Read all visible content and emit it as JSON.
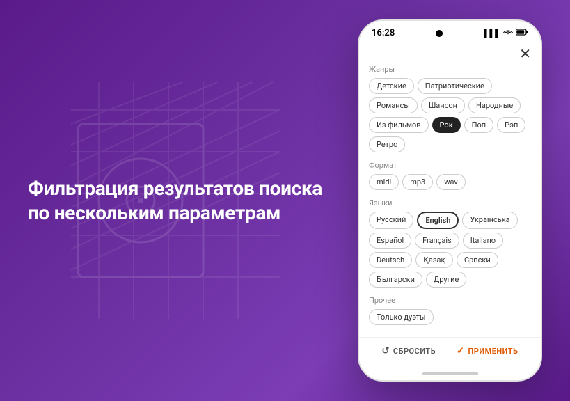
{
  "background": {
    "color": "#6b2fa0"
  },
  "left": {
    "title": "Фильтрация результатов поиска по нескольким параметрам"
  },
  "phone": {
    "status_bar": {
      "time": "16:28",
      "notch": "●",
      "signal": "▌▌▌",
      "wifi": "WiFi",
      "battery": "▮"
    },
    "close_button": "✕",
    "sections": [
      {
        "id": "genres",
        "label": "Жанры",
        "tags": [
          {
            "label": "Детские",
            "active": false
          },
          {
            "label": "Патриотические",
            "active": false
          },
          {
            "label": "Романсы",
            "active": false
          },
          {
            "label": "Шансон",
            "active": false
          },
          {
            "label": "Народные",
            "active": false
          },
          {
            "label": "Из фильмов",
            "active": false
          },
          {
            "label": "Рок",
            "active": true
          },
          {
            "label": "Поп",
            "active": false
          },
          {
            "label": "Рэп",
            "active": false
          },
          {
            "label": "Ретро",
            "active": false
          }
        ]
      },
      {
        "id": "format",
        "label": "Формат",
        "tags": [
          {
            "label": "midi",
            "active": false
          },
          {
            "label": "mp3",
            "active": false
          },
          {
            "label": "wav",
            "active": false
          }
        ]
      },
      {
        "id": "languages",
        "label": "Языки",
        "tags": [
          {
            "label": "Русский",
            "active": false
          },
          {
            "label": "English",
            "active": true,
            "highlight": true
          },
          {
            "label": "Українська",
            "active": false
          },
          {
            "label": "Español",
            "active": false
          },
          {
            "label": "Français",
            "active": false
          },
          {
            "label": "Italiano",
            "active": false
          },
          {
            "label": "Deutsch",
            "active": false
          },
          {
            "label": "Қазақ",
            "active": false
          },
          {
            "label": "Српски",
            "active": false
          },
          {
            "label": "Български",
            "active": false
          },
          {
            "label": "Другие",
            "active": false
          }
        ]
      },
      {
        "id": "other",
        "label": "Прочее",
        "tags": [
          {
            "label": "Только дуэты",
            "active": false
          }
        ]
      }
    ],
    "footer": {
      "reset_label": "СБРОСИТЬ",
      "apply_label": "ПРИМЕНИТЬ"
    }
  }
}
